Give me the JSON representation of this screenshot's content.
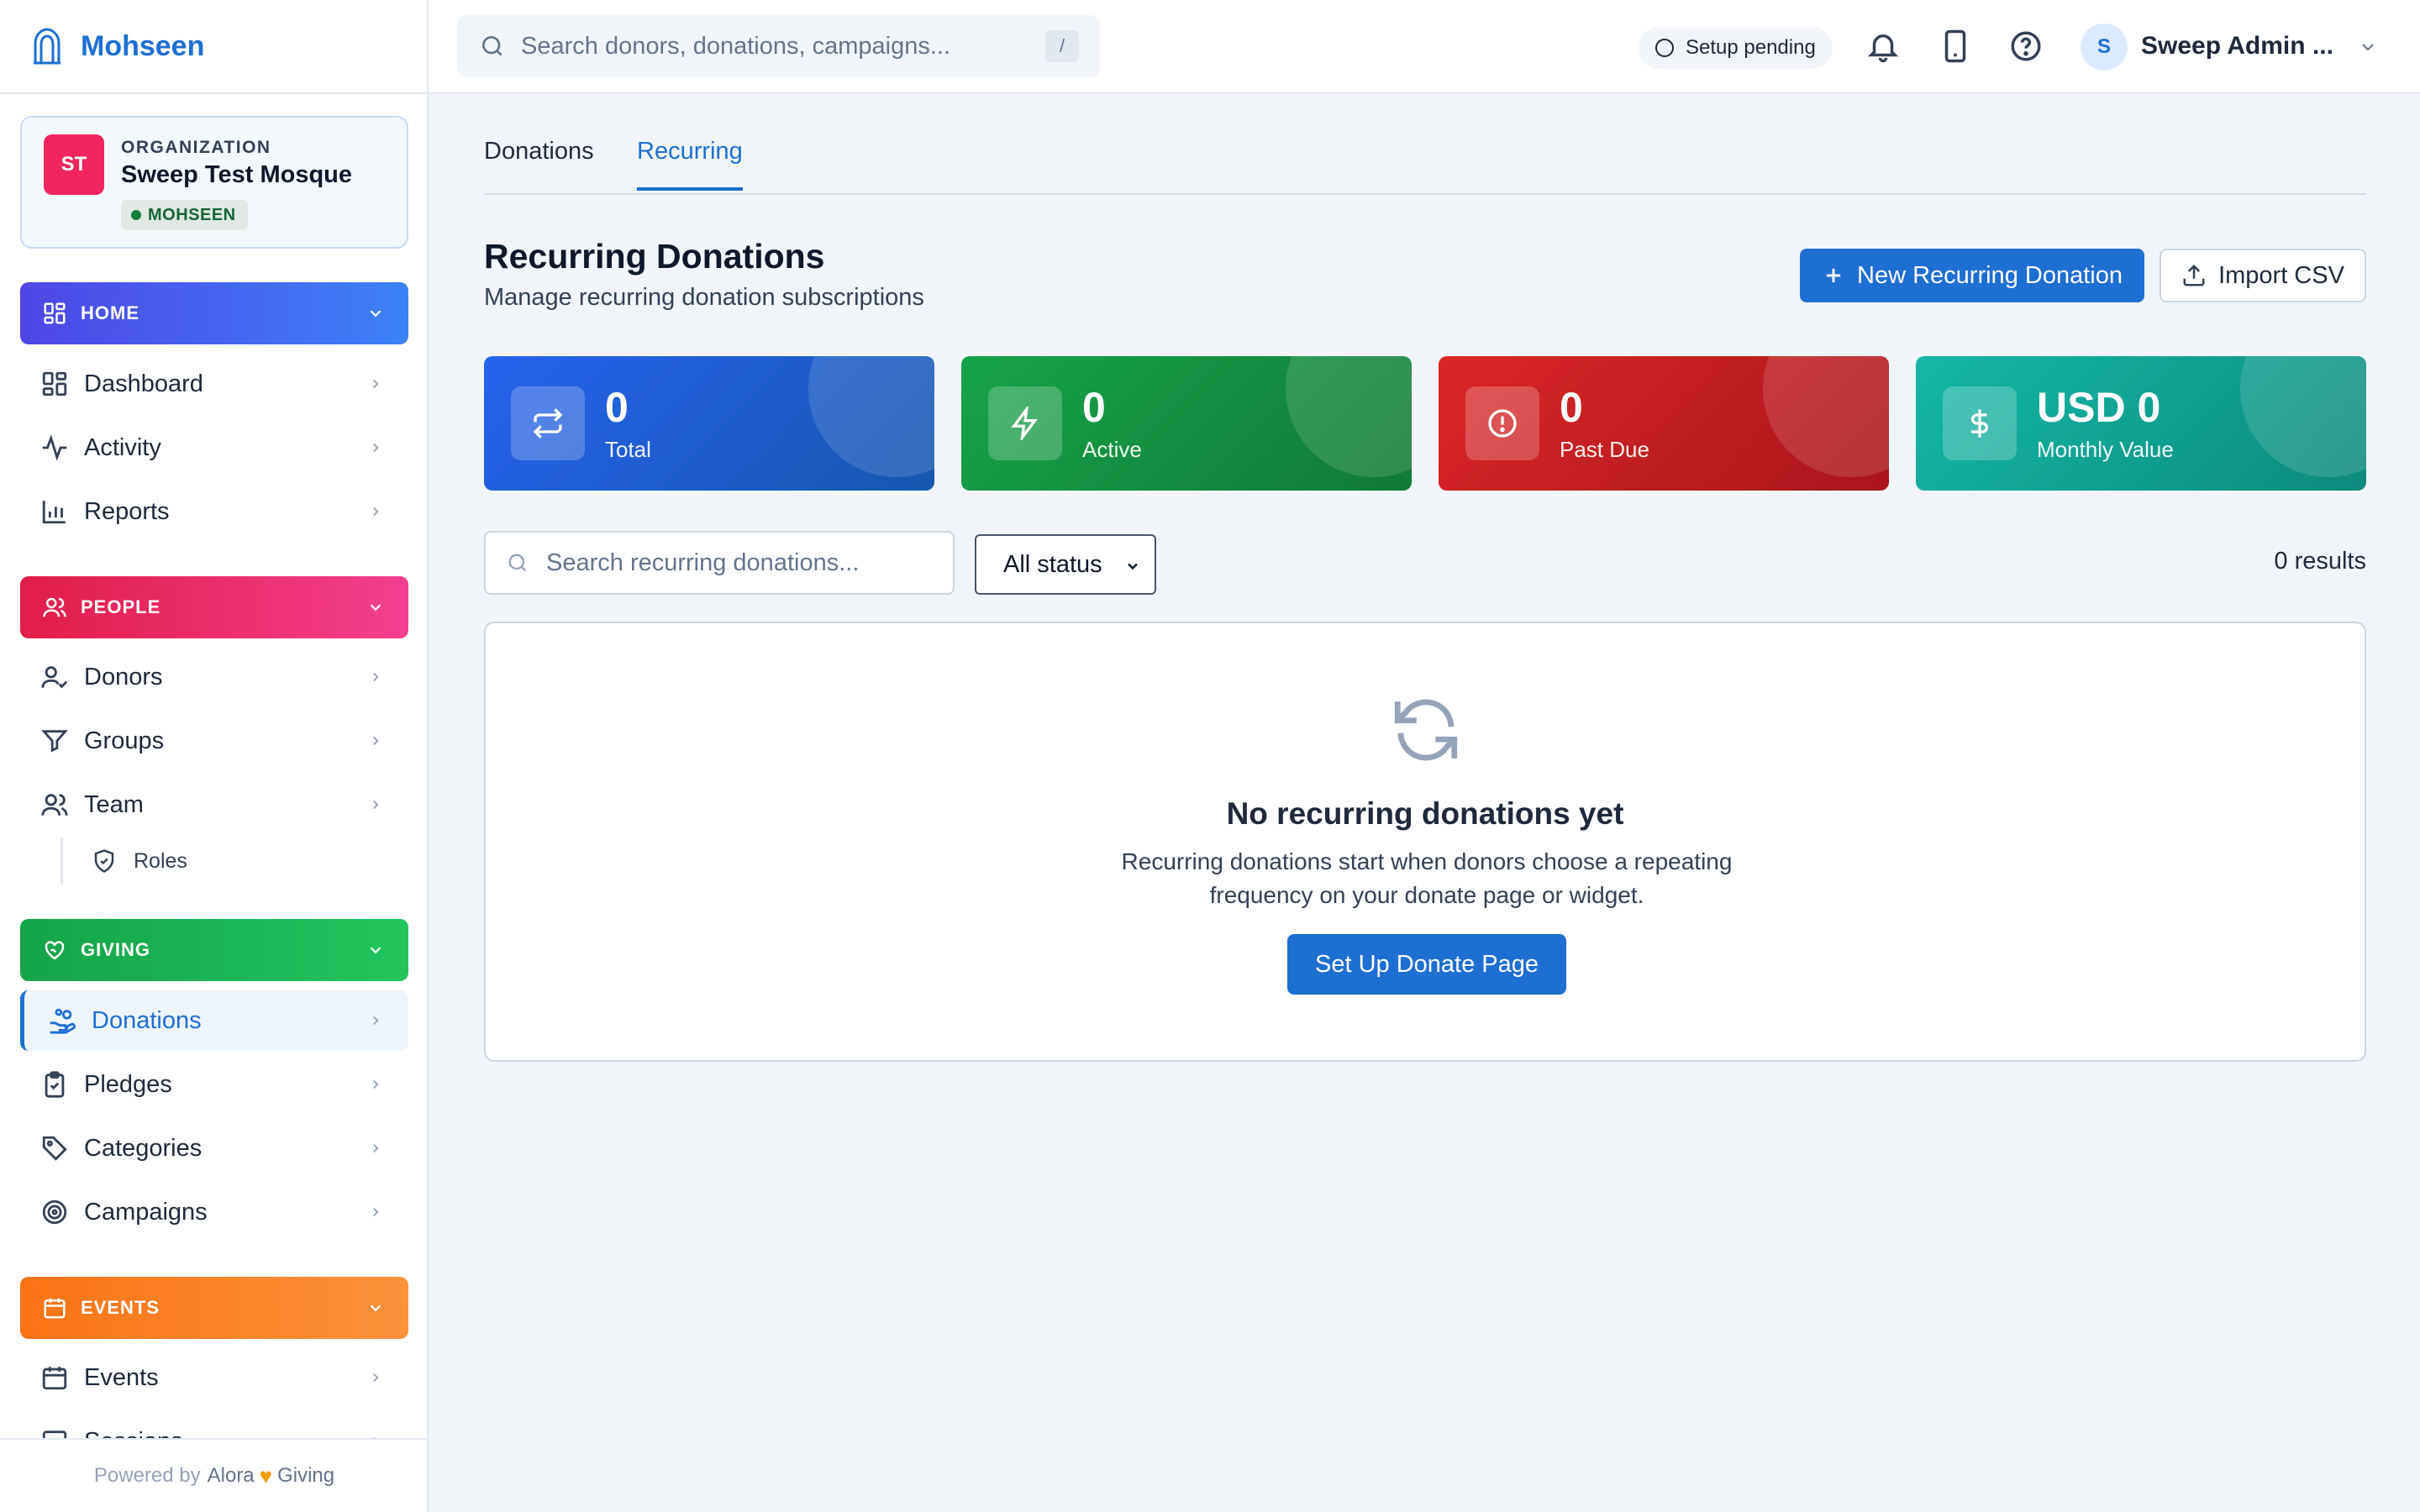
{
  "brand": {
    "name": "Mohseen"
  },
  "organization": {
    "label": "ORGANIZATION",
    "initials": "ST",
    "name": "Sweep Test Mosque",
    "tag": "MOHSEEN"
  },
  "sidebar": {
    "sections": {
      "home": {
        "label": "HOME",
        "items": [
          "Dashboard",
          "Activity",
          "Reports"
        ]
      },
      "people": {
        "label": "PEOPLE",
        "items": [
          "Donors",
          "Groups",
          "Team"
        ],
        "sub_items": [
          "Roles"
        ]
      },
      "giving": {
        "label": "GIVING",
        "items": [
          "Donations",
          "Pledges",
          "Categories",
          "Campaigns"
        ]
      },
      "events": {
        "label": "EVENTS",
        "items": [
          "Events",
          "Sessions"
        ]
      }
    },
    "active_item": "Donations",
    "footer": {
      "prefix": "Powered by",
      "brand_a": "Alora",
      "brand_b": "Giving"
    }
  },
  "topbar": {
    "search_placeholder": "Search donors, donations, campaigns...",
    "search_shortcut": "/",
    "setup_status": "Setup pending",
    "user_initial": "S",
    "user_name": "Sweep Admin ...",
    "icons": [
      "bell-icon",
      "mobile-icon",
      "help-icon"
    ]
  },
  "tabs": [
    {
      "label": "Donations",
      "active": false
    },
    {
      "label": "Recurring",
      "active": true
    }
  ],
  "page": {
    "title": "Recurring Donations",
    "subtitle": "Manage recurring donation subscriptions",
    "primary_button": "New Recurring Donation",
    "secondary_button": "Import CSV"
  },
  "stats": [
    {
      "value": "0",
      "label": "Total",
      "icon": "repeat-icon",
      "color": "#2563eb"
    },
    {
      "value": "0",
      "label": "Active",
      "icon": "lightning-icon",
      "color": "#16a34a"
    },
    {
      "value": "0",
      "label": "Past Due",
      "icon": "alert-circle-icon",
      "color": "#dc2626"
    },
    {
      "value": "USD 0",
      "label": "Monthly Value",
      "icon": "dollar-icon",
      "color": "#14b8a6"
    }
  ],
  "filters": {
    "search_placeholder": "Search recurring donations...",
    "status_value": "All status",
    "results": "0 results"
  },
  "empty_state": {
    "title": "No recurring donations yet",
    "description": "Recurring donations start when donors choose a repeating frequency on your donate page or widget.",
    "button": "Set Up Donate Page"
  },
  "colors": {
    "accent": "#1d6fd1",
    "home": "#4f46e5",
    "people": "#e11d48",
    "giving": "#16a34a",
    "events": "#f97316"
  }
}
